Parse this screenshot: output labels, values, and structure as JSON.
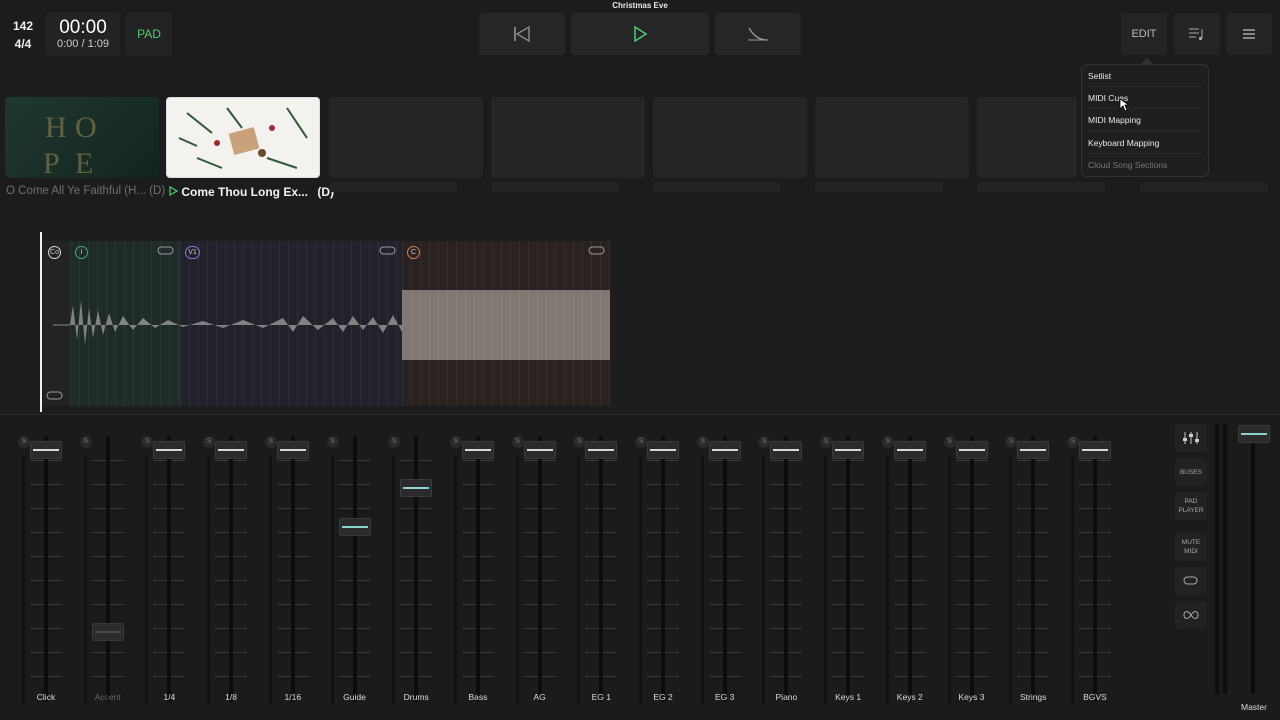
{
  "setlist_name": "Christmas Eve",
  "transport": {
    "tempo": "142",
    "time_signature": "4/4",
    "time": "00:00",
    "elapsed_total": "0:00 / 1:09",
    "pad_label": "PAD"
  },
  "toolbar": {
    "edit_label": "EDIT"
  },
  "menu": {
    "items": [
      "Setlist",
      "MIDI Cues",
      "MIDI Mapping",
      "Keyboard Mapping",
      "Cloud Song Sections"
    ]
  },
  "songs": [
    {
      "title": "O Come All Ye Faithful (H...",
      "key": "(D)",
      "state": "previous"
    },
    {
      "title": "Come Thou Long Ex...",
      "key": "(D)",
      "state": "playing"
    }
  ],
  "sections": [
    {
      "marker": "Co",
      "color": "#ffffff"
    },
    {
      "marker": "I",
      "color": "#3fae8e"
    },
    {
      "marker": "V1",
      "color": "#8a78d8"
    },
    {
      "marker": "C",
      "color": "#e07a4a"
    }
  ],
  "mixer": {
    "solo_label": "S",
    "channels": [
      {
        "name": "Click",
        "level": 0.98
      },
      {
        "name": "Accent",
        "level": 0.22
      },
      {
        "name": "1/4",
        "level": 0.98
      },
      {
        "name": "1/8",
        "level": 0.98
      },
      {
        "name": "1/16",
        "level": 0.98
      },
      {
        "name": "Guide",
        "level": 0.66
      },
      {
        "name": "Drums",
        "level": 0.82
      },
      {
        "name": "Bass",
        "level": 0.98
      },
      {
        "name": "AG",
        "level": 0.98
      },
      {
        "name": "EG 1",
        "level": 0.98
      },
      {
        "name": "EG 2",
        "level": 0.98
      },
      {
        "name": "EG 3",
        "level": 0.98
      },
      {
        "name": "Piano",
        "level": 0.98
      },
      {
        "name": "Keys 1",
        "level": 0.98
      },
      {
        "name": "Keys 2",
        "level": 0.98
      },
      {
        "name": "Keys 3",
        "level": 0.98
      },
      {
        "name": "Strings",
        "level": 0.98
      },
      {
        "name": "BGVS",
        "level": 0.98
      }
    ],
    "side_buttons": [
      "BUSES",
      "PAD PLAYER",
      "MUTE MIDI"
    ],
    "master_label": "Master"
  }
}
